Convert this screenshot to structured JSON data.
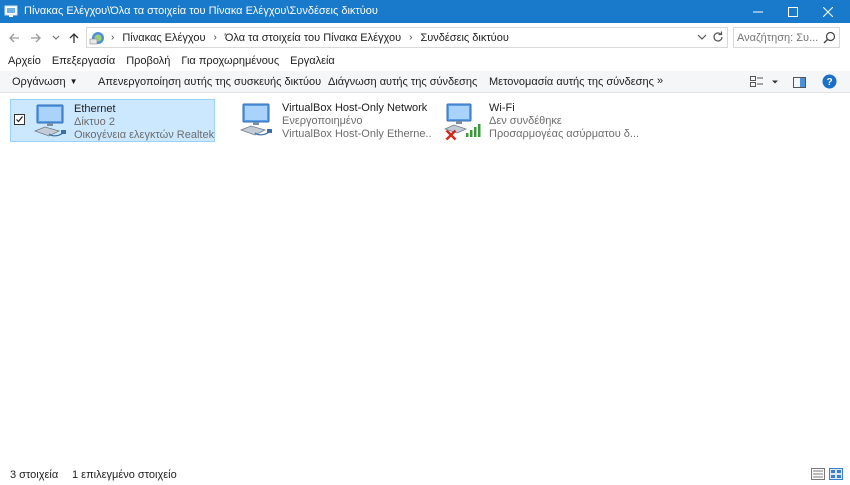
{
  "window": {
    "title": "Πίνακας Ελέγχου\\Όλα τα στοιχεία του Πίνακα Ελέγχου\\Συνδέσεις δικτύου",
    "accent_color": "#1979ca"
  },
  "address": {
    "crumbs": [
      "Πίνακας Ελέγχου",
      "Όλα τα στοιχεία του Πίνακα Ελέγχου",
      "Συνδέσεις δικτύου"
    ]
  },
  "search": {
    "placeholder": "Αναζήτηση: Συ..."
  },
  "menu": {
    "items": [
      "Αρχείο",
      "Επεξεργασία",
      "Προβολή",
      "Για προχωρημένους",
      "Εργαλεία"
    ]
  },
  "commands": {
    "organize": "Οργάνωση",
    "disable": "Απενεργοποίηση αυτής της συσκευής δικτύου",
    "diagnose": "Διάγνωση αυτής της σύνδεσης",
    "rename": "Μετονομασία αυτής της σύνδεσης",
    "more": "»"
  },
  "connections": [
    {
      "name": "Ethernet",
      "line2": "Δίκτυο 2",
      "line3": "Οικογένεια ελεγκτών Realtek ...",
      "selected": true,
      "icon": "ethernet-adapter-icon"
    },
    {
      "name": "VirtualBox Host-Only Network",
      "line2": "Ενεργοποιημένο",
      "line3": "VirtualBox Host-Only Etherne...",
      "selected": false,
      "icon": "ethernet-adapter-icon"
    },
    {
      "name": "Wi-Fi",
      "line2": "Δεν συνδέθηκε",
      "line3": "Προσαρμογέας ασύρματου δ...",
      "selected": false,
      "icon": "wifi-adapter-icon"
    }
  ],
  "status": {
    "count": "3 στοιχεία",
    "selected": "1 επιλεγμένο στοιχείο"
  }
}
